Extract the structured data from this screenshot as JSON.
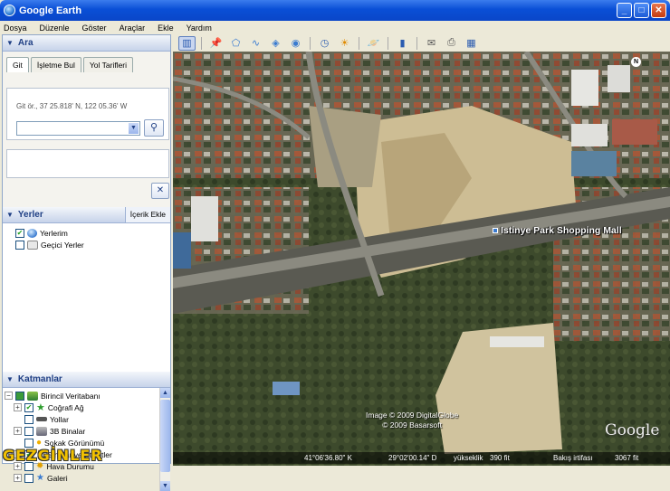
{
  "window": {
    "title": "Google Earth"
  },
  "menu": [
    "Dosya",
    "Düzenle",
    "Göster",
    "Araçlar",
    "Ekle",
    "Yardım"
  ],
  "search": {
    "header": "Ara",
    "tabs": [
      "Git",
      "İşletme Bul",
      "Yol Tarifleri"
    ],
    "hint": "Git ör., 37 25.818' N, 122 05.36' W",
    "query": ""
  },
  "places": {
    "header": "Yerler",
    "add_content": "İçerik Ekle",
    "items": [
      {
        "label": "Yerlerim",
        "checked": true,
        "icon": "globe-icon"
      },
      {
        "label": "Geçici Yerler",
        "checked": false,
        "icon": "folder-icon"
      }
    ]
  },
  "layers": {
    "header": "Katmanlar",
    "items": [
      {
        "label": "Birincil Veritabanı",
        "checked": true,
        "icon": "layers-icon"
      },
      {
        "label": "Coğrafi Ağ",
        "checked": true,
        "icon": "star-icon"
      },
      {
        "label": "Yollar",
        "checked": false,
        "icon": "road-icon"
      },
      {
        "label": "3B Binalar",
        "checked": false,
        "icon": "building-icon"
      },
      {
        "label": "Sokak Görünümü",
        "checked": false,
        "icon": "pegman-icon"
      },
      {
        "label": "Sınırlar ve Etiketler",
        "checked": true,
        "icon": "flag-icon"
      },
      {
        "label": "Hava Durumu",
        "checked": false,
        "icon": "weather-icon"
      },
      {
        "label": "Galeri",
        "checked": false,
        "icon": "gallery-icon"
      }
    ]
  },
  "map": {
    "place_label": "Istinye Park Shopping Mall",
    "copyright_line1": "Image © 2009 DigitalGlobe",
    "copyright_line2": "© 2009 Basarsoft",
    "logo": "Google",
    "north": "N"
  },
  "status": {
    "lat": "41°06'36.80\" K",
    "lon": "29°02'00.14\" D",
    "elev_label": "yükseklik",
    "elev_value": "390 fit",
    "eye_label": "Bakış irtifası",
    "eye_value": "3067 fit"
  },
  "watermark": "GEZGİNLER"
}
